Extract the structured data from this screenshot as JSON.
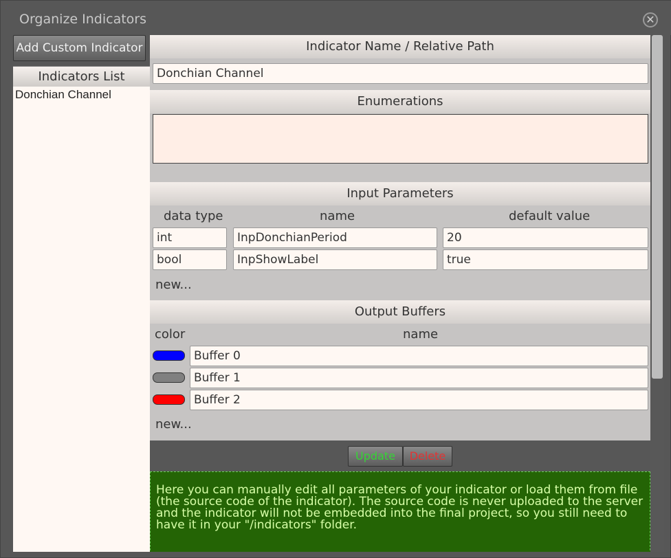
{
  "window": {
    "title": "Organize Indicators",
    "close_glyph": "✕"
  },
  "left": {
    "add_button": "Add Custom Indicator",
    "list_title": "Indicators List",
    "items": [
      "Donchian Channel"
    ]
  },
  "sections": {
    "name_title": "Indicator Name / Relative Path",
    "name_value": "Donchian Channel",
    "enum_title": "Enumerations",
    "input_title": "Input Parameters",
    "output_title": "Output Buffers"
  },
  "inputs": {
    "col_type": "data type",
    "col_name": "name",
    "col_default": "default value",
    "rows": [
      {
        "type": "int",
        "name": "InpDonchianPeriod",
        "default": "20"
      },
      {
        "type": "bool",
        "name": "InpShowLabel",
        "default": "true"
      }
    ],
    "new_label": "new..."
  },
  "outputs": {
    "col_color": "color",
    "col_name": "name",
    "rows": [
      {
        "color": "#0000ff",
        "name": "Buffer 0"
      },
      {
        "color": "#808080",
        "name": "Buffer 1"
      },
      {
        "color": "#ff0000",
        "name": "Buffer 2"
      }
    ],
    "new_label": "new..."
  },
  "actions": {
    "update": "Update",
    "delete": "Delete"
  },
  "info_text": "Here you can manually edit all parameters of your indicator or load them from file (the source code of the indicator). The source code is never uploaded to the server and the indicator will not be embedded into the final project, so you still need to have it in your \"/indicators\" folder."
}
